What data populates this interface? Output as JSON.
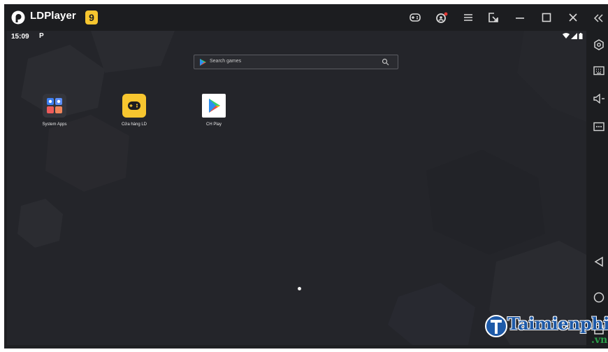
{
  "window": {
    "app_title": "LDPlayer",
    "version_badge": "9"
  },
  "titlebar_icons": [
    "gamepad-icon",
    "account-icon",
    "menu-icon",
    "multi-instance-icon",
    "minimize-icon",
    "maximize-icon",
    "close-icon"
  ],
  "statusbar": {
    "time": "15:09",
    "notification": "P"
  },
  "search": {
    "placeholder": "Search games"
  },
  "apps": [
    {
      "label": "System Apps",
      "icon": "folder-icon"
    },
    {
      "label": "Cửa hàng LD",
      "icon": "ld-store-icon"
    },
    {
      "label": "CH Play",
      "icon": "play-store-icon"
    }
  ],
  "sidebar_icons": [
    "collapse-icon",
    "settings-icon",
    "keyboard-icon",
    "volume-icon",
    "more-icon",
    "back-icon",
    "home-icon",
    "recents-icon"
  ],
  "watermark": {
    "brand": "Taimienphi",
    "tld": ".vn"
  },
  "colors": {
    "titlebar": "#1c1d20",
    "screen": "#24252a",
    "accent_yellow": "#f7c62f",
    "watermark_blue": "#1e5aa8",
    "watermark_green": "#2aa24a"
  }
}
